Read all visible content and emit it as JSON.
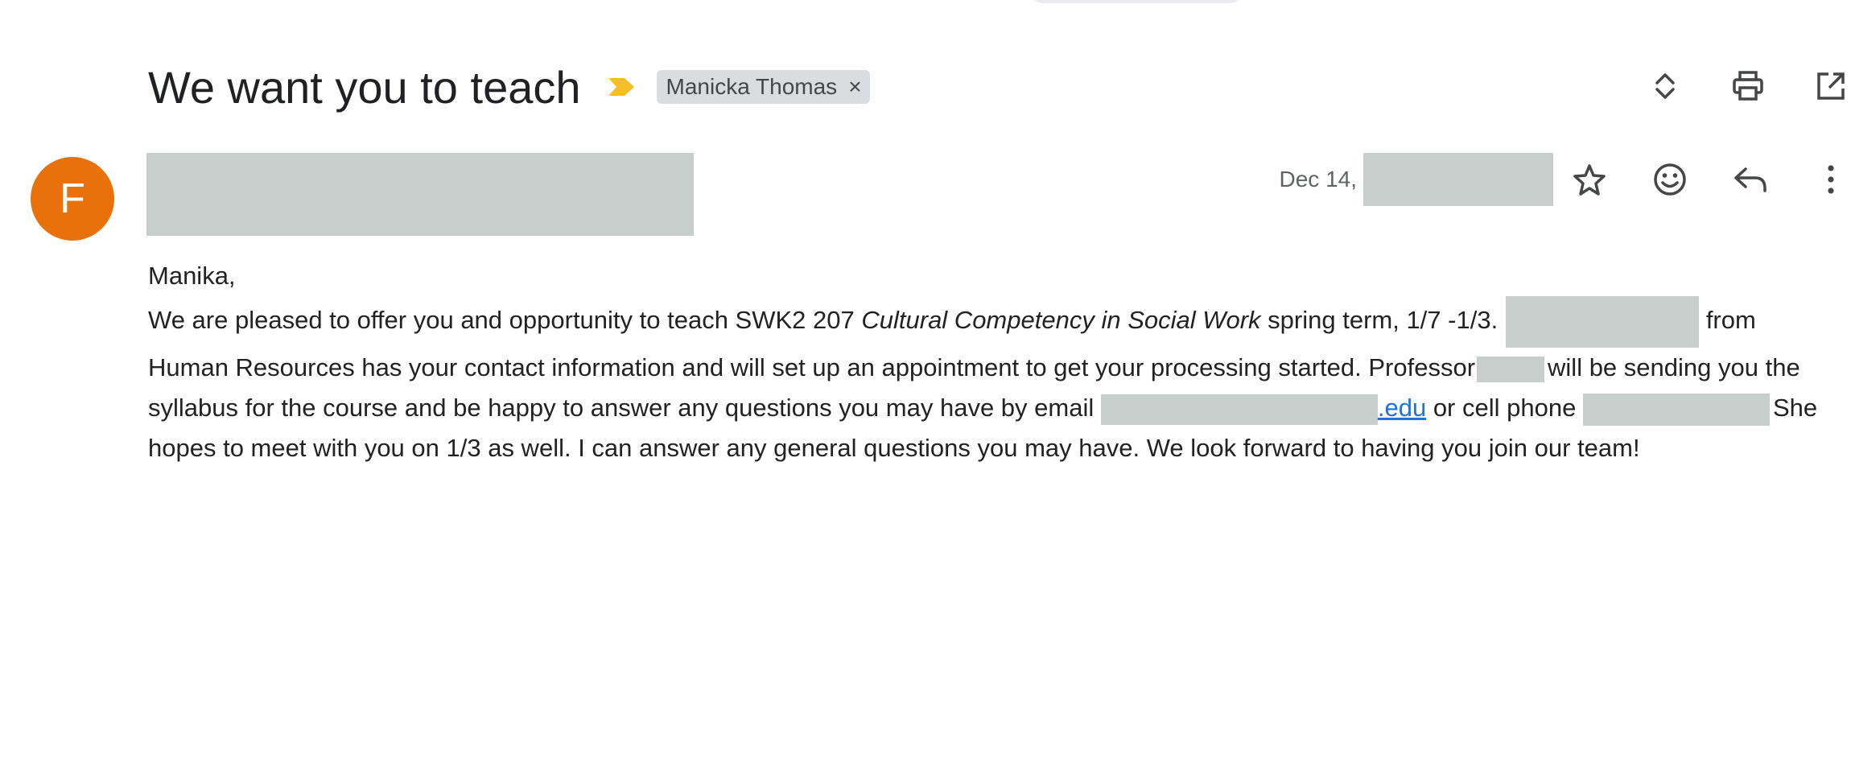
{
  "email": {
    "subject": "We want you to teach",
    "label_chip": "Manicka Thomas",
    "label_chip_close": "×",
    "sender_avatar_letter": "F",
    "date_prefix": "Dec 14,",
    "body": {
      "greeting": "Manika,",
      "p1_before_italic": "We are pleased to offer you and opportunity to teach SWK2 207 ",
      "course_title": "Cultural Competency in Social Work",
      "p1_after_italic": " spring term, 1/7 -1/3.",
      "p1_continued": "from Human Resources has your contact information and will set up an appointment to get your processing started. Professor",
      "p1_after_prof": "will be sending you the syllabus for the course and be happy to answer any questions you may have by email",
      "email_link_suffix": ".edu",
      "p1_after_email": " or cell phone ",
      "p1_end": "She hopes to meet with you on 1/3 as well.  I can answer any general questions you may have.  We look forward to having you join our team!"
    }
  },
  "icons": {
    "importance": "importance-marker-icon",
    "chip_close": "close-icon",
    "expand": "expand-all-icon",
    "print": "print-icon",
    "open_new": "open-in-new-window-icon",
    "star": "star-icon",
    "emoji": "emoji-reaction-icon",
    "reply": "reply-icon",
    "more": "more-vert-icon"
  },
  "colors": {
    "avatar": "#e8710a",
    "importance": "#f6bf26",
    "chip_bg": "#dadce0",
    "redaction": "#c7cfcd",
    "link": "#1a73e8"
  }
}
